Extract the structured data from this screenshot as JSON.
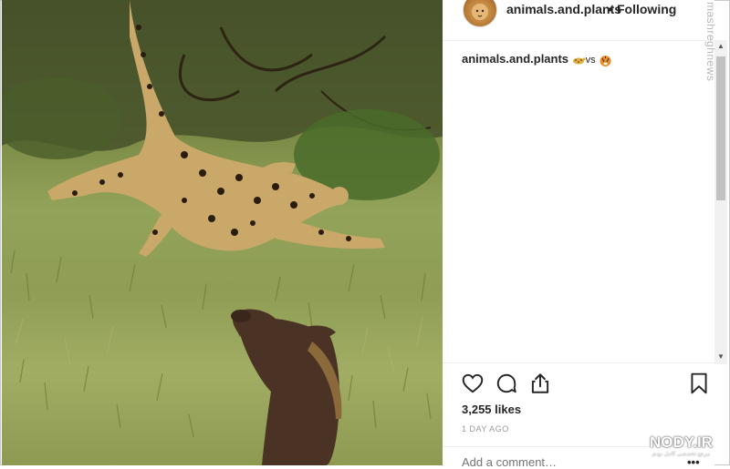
{
  "post": {
    "image_alt": "leopard leaping at warthog in grass",
    "username": "animals.and.plants",
    "separator": "•",
    "follow_status": "Following"
  },
  "caption": {
    "username": "animals.and.plants",
    "emoji_1": "leopard-emoji",
    "vs_text": "vs",
    "emoji_2": "tiger-face-emoji"
  },
  "actions": {
    "like_icon": "heart-icon",
    "comment_icon": "comment-icon",
    "share_icon": "share-icon",
    "save_icon": "bookmark-icon"
  },
  "likes_text": "3,255 likes",
  "time_ago": "1 DAY AGO",
  "comment": {
    "placeholder": "Add a comment…",
    "more_label": "•••"
  },
  "watermarks": {
    "side": "mashreghnews",
    "brand": "NODY.IR",
    "brand_sub": "مرجع تخصصی کامل نودی"
  },
  "colors": {
    "text": "#262626",
    "muted": "#999999",
    "divider": "#efefef"
  }
}
